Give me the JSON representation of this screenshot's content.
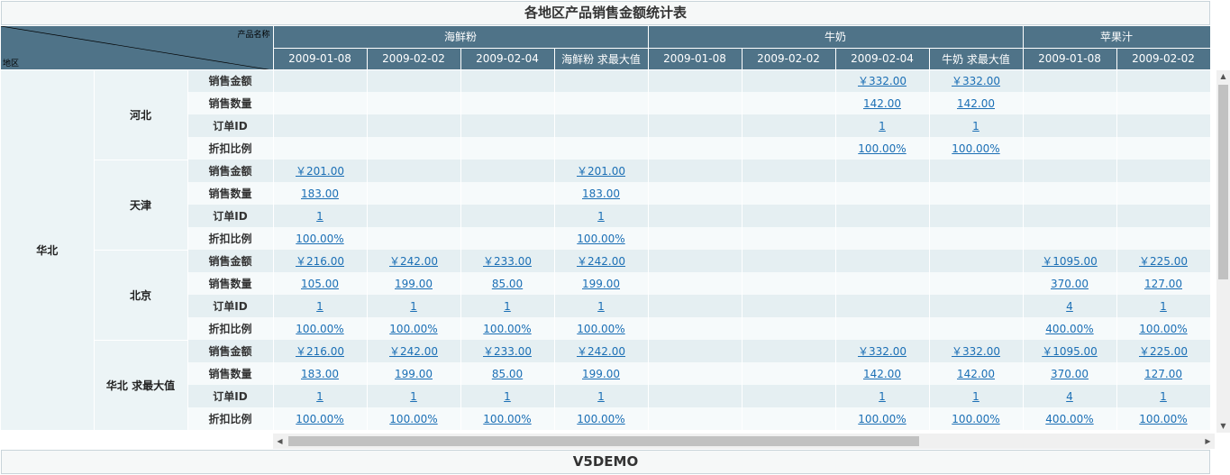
{
  "title": "各地区产品销售金额统计表",
  "footer": "V5DEMO",
  "corner": {
    "product_label": "产品名称",
    "area_label": "地区"
  },
  "products": [
    {
      "name": "海鲜粉",
      "span": 4
    },
    {
      "name": "牛奶",
      "span": 4
    },
    {
      "name": "苹果汁",
      "span": 2
    }
  ],
  "columns": [
    "2009-01-08",
    "2009-02-02",
    "2009-02-04",
    "海鲜粉 求最大值",
    "2009-01-08",
    "2009-02-02",
    "2009-02-04",
    "牛奶 求最大值",
    "2009-01-08",
    "2009-02-02"
  ],
  "region": "华北",
  "metrics": [
    "销售金额",
    "销售数量",
    "订单ID",
    "折扣比例"
  ],
  "groups": [
    {
      "name": "河北",
      "rows": [
        [
          "",
          "",
          "",
          "",
          "",
          "",
          "￥332.00",
          "￥332.00",
          "",
          ""
        ],
        [
          "",
          "",
          "",
          "",
          "",
          "",
          "142.00",
          "142.00",
          "",
          ""
        ],
        [
          "",
          "",
          "",
          "",
          "",
          "",
          "1",
          "1",
          "",
          ""
        ],
        [
          "",
          "",
          "",
          "",
          "",
          "",
          "100.00%",
          "100.00%",
          "",
          ""
        ]
      ]
    },
    {
      "name": "天津",
      "rows": [
        [
          "￥201.00",
          "",
          "",
          "￥201.00",
          "",
          "",
          "",
          "",
          "",
          ""
        ],
        [
          "183.00",
          "",
          "",
          "183.00",
          "",
          "",
          "",
          "",
          "",
          ""
        ],
        [
          "1",
          "",
          "",
          "1",
          "",
          "",
          "",
          "",
          "",
          ""
        ],
        [
          "100.00%",
          "",
          "",
          "100.00%",
          "",
          "",
          "",
          "",
          "",
          ""
        ]
      ]
    },
    {
      "name": "北京",
      "rows": [
        [
          "￥216.00",
          "￥242.00",
          "￥233.00",
          "￥242.00",
          "",
          "",
          "",
          "",
          "￥1095.00",
          "￥225.00"
        ],
        [
          "105.00",
          "199.00",
          "85.00",
          "199.00",
          "",
          "",
          "",
          "",
          "370.00",
          "127.00"
        ],
        [
          "1",
          "1",
          "1",
          "1",
          "",
          "",
          "",
          "",
          "4",
          "1"
        ],
        [
          "100.00%",
          "100.00%",
          "100.00%",
          "100.00%",
          "",
          "",
          "",
          "",
          "400.00%",
          "100.00%"
        ]
      ]
    },
    {
      "name": "华北 求最大值",
      "rows": [
        [
          "￥216.00",
          "￥242.00",
          "￥233.00",
          "￥242.00",
          "",
          "",
          "￥332.00",
          "￥332.00",
          "￥1095.00",
          "￥225.00"
        ],
        [
          "183.00",
          "199.00",
          "85.00",
          "199.00",
          "",
          "",
          "142.00",
          "142.00",
          "370.00",
          "127.00"
        ],
        [
          "1",
          "1",
          "1",
          "1",
          "",
          "",
          "1",
          "1",
          "4",
          "1"
        ],
        [
          "100.00%",
          "100.00%",
          "100.00%",
          "100.00%",
          "",
          "",
          "100.00%",
          "100.00%",
          "400.00%",
          "100.00%"
        ]
      ]
    }
  ]
}
